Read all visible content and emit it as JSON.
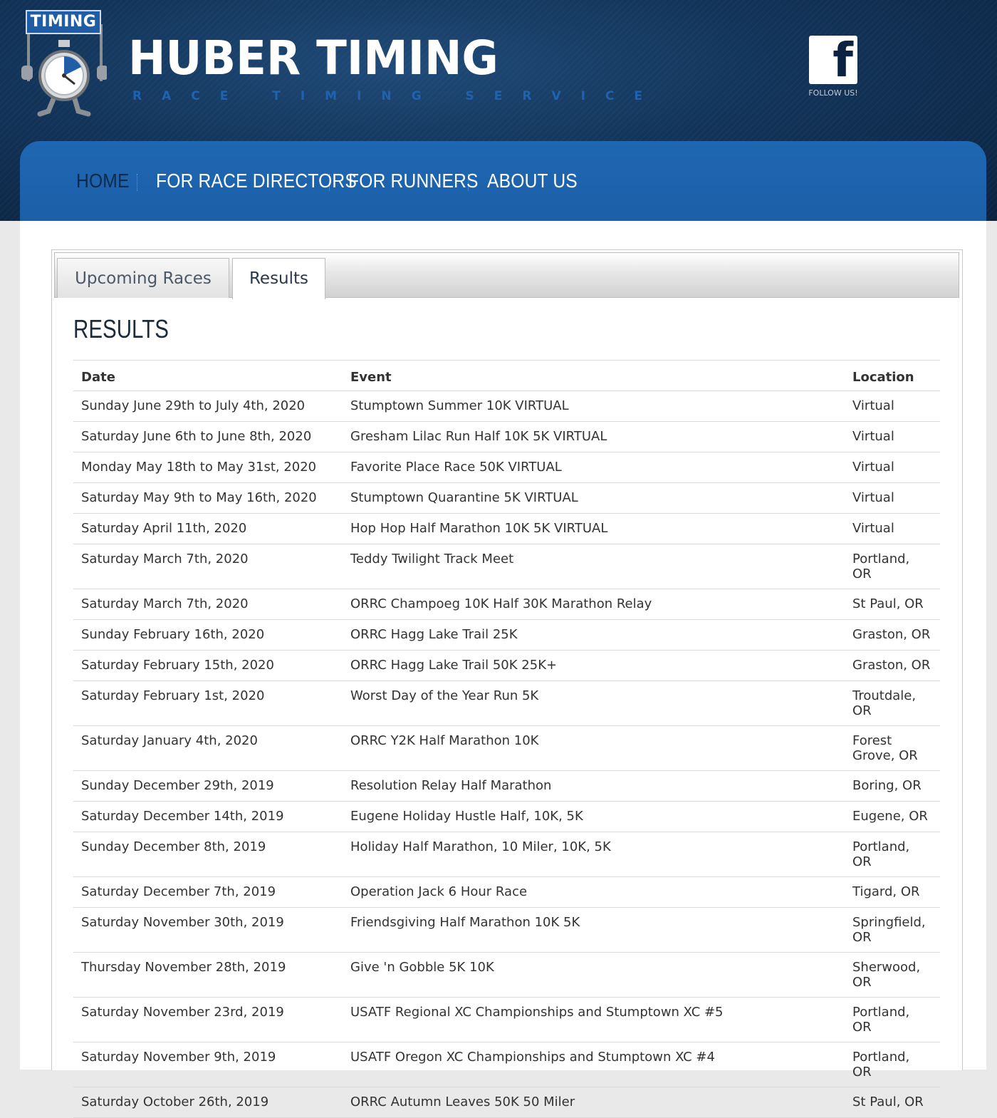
{
  "brand": {
    "flag_text": "TIMING",
    "name": "HUBER TIMING",
    "tagline": "RACE TIMING SERVICE",
    "facebook_follow": "FOLLOW US!"
  },
  "nav": {
    "items": [
      "HOME",
      "FOR RACE DIRECTORS",
      "FOR RUNNERS",
      "ABOUT US"
    ]
  },
  "tabs": {
    "upcoming": "Upcoming Races",
    "results": "Results"
  },
  "results": {
    "title": "RESULTS",
    "columns": {
      "date": "Date",
      "event": "Event",
      "location": "Location"
    },
    "rows": [
      {
        "date": "Sunday June 29th to July 4th, 2020",
        "event": "Stumptown Summer 10K VIRTUAL",
        "location": "Virtual"
      },
      {
        "date": "Saturday June 6th to June 8th, 2020",
        "event": "Gresham Lilac Run Half 10K 5K VIRTUAL",
        "location": "Virtual"
      },
      {
        "date": "Monday May 18th to May 31st, 2020",
        "event": "Favorite Place Race 50K VIRTUAL",
        "location": "Virtual"
      },
      {
        "date": "Saturday May 9th to May 16th, 2020",
        "event": "Stumptown Quarantine 5K VIRTUAL",
        "location": "Virtual"
      },
      {
        "date": "Saturday April 11th, 2020",
        "event": "Hop Hop Half Marathon 10K 5K VIRTUAL",
        "location": "Virtual"
      },
      {
        "date": "Saturday March 7th, 2020",
        "event": "Teddy Twilight Track Meet",
        "location": "Portland, OR"
      },
      {
        "date": "Saturday March 7th, 2020",
        "event": "ORRC Champoeg 10K Half 30K Marathon Relay",
        "location": "St Paul, OR"
      },
      {
        "date": "Sunday February 16th, 2020",
        "event": "ORRC Hagg Lake Trail 25K",
        "location": "Graston, OR"
      },
      {
        "date": "Saturday February 15th, 2020",
        "event": "ORRC Hagg Lake Trail 50K 25K+",
        "location": "Graston, OR"
      },
      {
        "date": "Saturday February 1st, 2020",
        "event": "Worst Day of the Year Run 5K",
        "location": "Troutdale, OR"
      },
      {
        "date": "Saturday January 4th, 2020",
        "event": "ORRC Y2K Half Marathon 10K",
        "location": "Forest Grove, OR"
      },
      {
        "date": "Sunday December 29th, 2019",
        "event": "Resolution Relay Half Marathon",
        "location": "Boring, OR"
      },
      {
        "date": "Saturday December 14th, 2019",
        "event": "Eugene Holiday Hustle Half, 10K, 5K",
        "location": "Eugene, OR"
      },
      {
        "date": "Sunday December 8th, 2019",
        "event": "Holiday Half Marathon, 10 Miler, 10K, 5K",
        "location": "Portland, OR"
      },
      {
        "date": "Saturday December 7th, 2019",
        "event": "Operation Jack 6 Hour Race",
        "location": "Tigard, OR"
      },
      {
        "date": "Saturday November 30th, 2019",
        "event": "Friendsgiving Half Marathon 10K 5K",
        "location": "Springfield, OR"
      },
      {
        "date": "Thursday November 28th, 2019",
        "event": "Give 'n Gobble 5K 10K",
        "location": "Sherwood, OR"
      },
      {
        "date": "Saturday November 23rd, 2019",
        "event": "USATF Regional XC Championships and Stumptown XC #5",
        "location": "Portland, OR"
      },
      {
        "date": "Saturday November 9th, 2019",
        "event": "USATF Oregon XC Championships and Stumptown XC #4",
        "location": "Portland, OR"
      },
      {
        "date": "Saturday October 26th, 2019",
        "event": "ORRC Autumn Leaves 50K 50 Miler",
        "location": "St Paul, OR"
      }
    ]
  }
}
